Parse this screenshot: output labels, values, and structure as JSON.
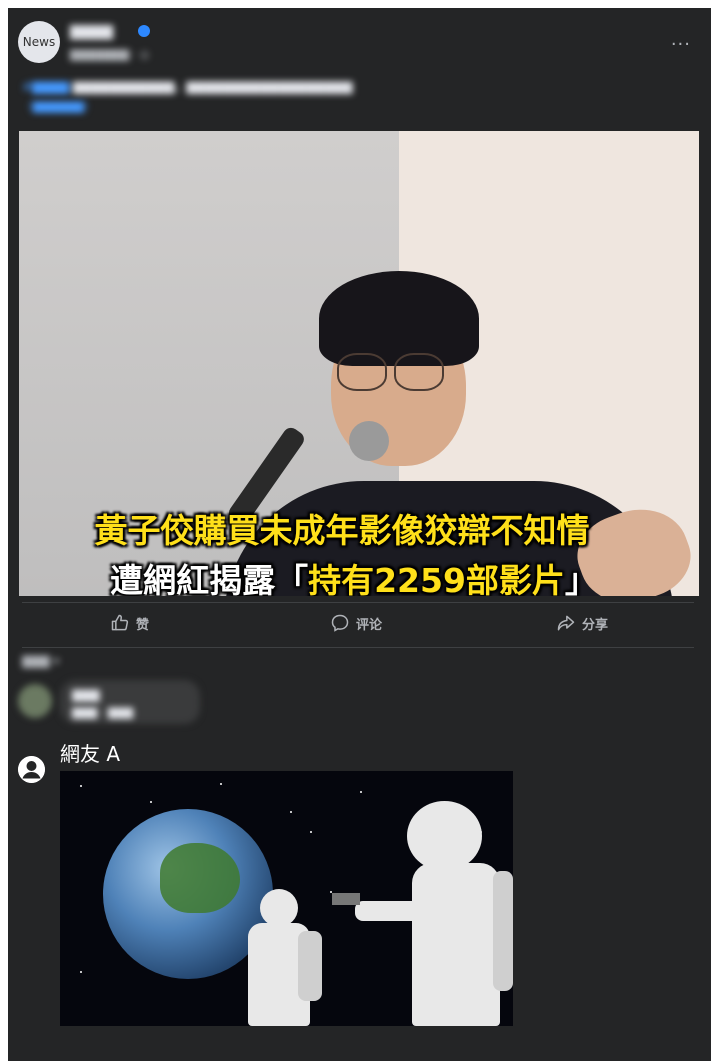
{
  "post": {
    "avatar_text": "News",
    "page_name": "▇▇▇▇",
    "time": "▇▇▇▇▇▇▇ · ◎",
    "more_label": "···",
    "caption_tag": "#▇▇▇▇",
    "caption_text": "▇▇▇▇▇▇▇▇▇▇▇，▇▇▇▇▇▇▇▇▇▇▇▇▇▇▇▇▇▇",
    "caption_link": "（▇▇▇▇▇▇）"
  },
  "photo": {
    "headline_line1": "黃子佼購買未成年影像狡辯不知情",
    "headline_line2_a": "遭網紅揭露「",
    "headline_line2_b": "持有2259部影片",
    "headline_line2_c": "」"
  },
  "actions": {
    "like": "赞",
    "comment": "评论",
    "share": "分享"
  },
  "comments": {
    "sort_label": "▇▇▇ ▾",
    "first": {
      "name": "▇▇▇",
      "text": "▇▇▇ · ▇▇▇"
    },
    "second": {
      "name": "網友 A"
    }
  },
  "colors": {
    "card_bg": "#242526",
    "headline_yellow": "#ffe01a",
    "link_blue": "#4599ff"
  }
}
